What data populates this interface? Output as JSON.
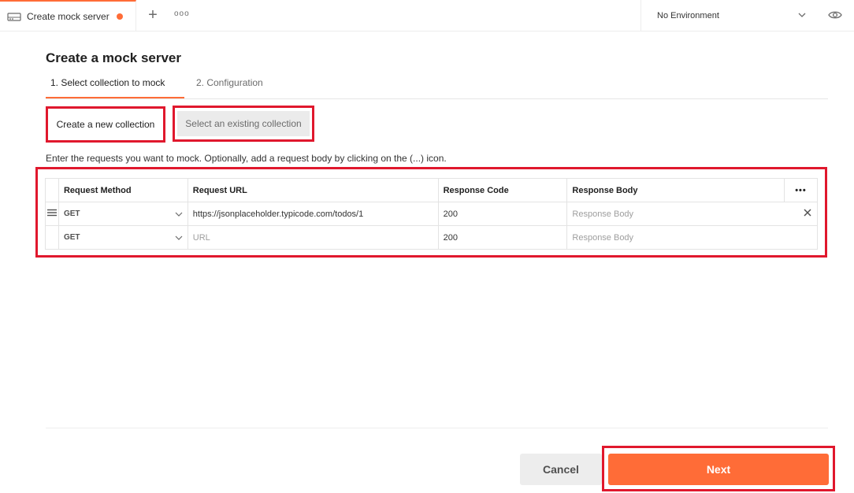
{
  "tabs": [
    {
      "title": "Create mock server",
      "unsaved": true
    }
  ],
  "topbar": {
    "new_tab": "+",
    "more": "ooo",
    "environment": "No Environment"
  },
  "page": {
    "title": "Create a mock server",
    "steps": [
      {
        "label": "1.  Select collection to mock",
        "active": true
      },
      {
        "label": "2.  Configuration",
        "active": false
      }
    ],
    "options": {
      "new": "Create a new collection",
      "existing": "Select an existing collection"
    },
    "instructions": "Enter the requests you want to mock. Optionally, add a request body by clicking on the (...) icon."
  },
  "table": {
    "headers": [
      "Request Method",
      "Request URL",
      "Response Code",
      "Response Body"
    ],
    "more": "•••",
    "rows": [
      {
        "method": "GET",
        "url": "https://jsonplaceholder.typicode.com/todos/1",
        "url_placeholder": "",
        "code": "200",
        "body_placeholder": "Response Body"
      },
      {
        "method": "GET",
        "url": "",
        "url_placeholder": "URL",
        "code": "200",
        "body_placeholder": "Response Body"
      }
    ]
  },
  "footer": {
    "cancel": "Cancel",
    "next": "Next"
  },
  "colors": {
    "accent": "#ff6c37",
    "highlight": "#e0182d"
  }
}
